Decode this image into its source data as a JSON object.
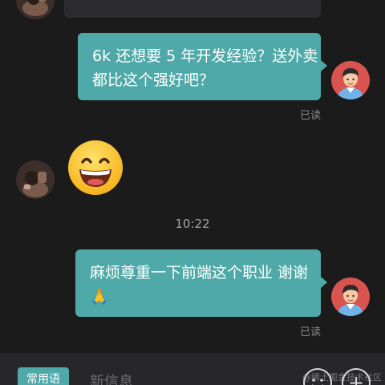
{
  "messages": {
    "out1": {
      "lines": [
        "6k 还想要 5 年开发经验？送外卖",
        "都比这个强好吧？"
      ],
      "status": "已读"
    },
    "in_emoji": {
      "icon": "grinning-face-emoji"
    },
    "timestamp": "10:22",
    "out2": {
      "line1": "麻烦尊重一下前端这个职业 谢谢",
      "line2": "🙏",
      "status": "已读"
    }
  },
  "input_bar": {
    "phrases_label": "常用语",
    "message_placeholder": "新信息",
    "emoji_button_icon": "smiley-icon",
    "plus_button_icon": "plus-icon",
    "plus_label": "+"
  },
  "watermark": "@稀土掘金技术社区",
  "colors": {
    "background": "#1b1b1c",
    "bubble_out": "#4fa9a8",
    "bubble_in": "#2c2c2e"
  }
}
